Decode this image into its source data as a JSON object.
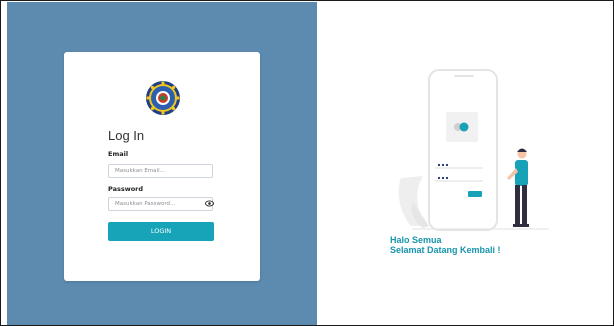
{
  "login": {
    "title": "Log In",
    "email_label": "Email",
    "email_placeholder": "Masukkan Email...",
    "password_label": "Password",
    "password_placeholder": "Masukkan Password...",
    "button_label": "LOGIN"
  },
  "greeting": {
    "line1": "Halo Semua",
    "line2": "Selamat Datang Kembali !"
  },
  "icons": {
    "logo": "university-seal-icon",
    "password_toggle": "eye-icon"
  },
  "colors": {
    "left_background": "#5d8bb0",
    "accent": "#18a4b8",
    "greeting_text": "#1795ad"
  }
}
